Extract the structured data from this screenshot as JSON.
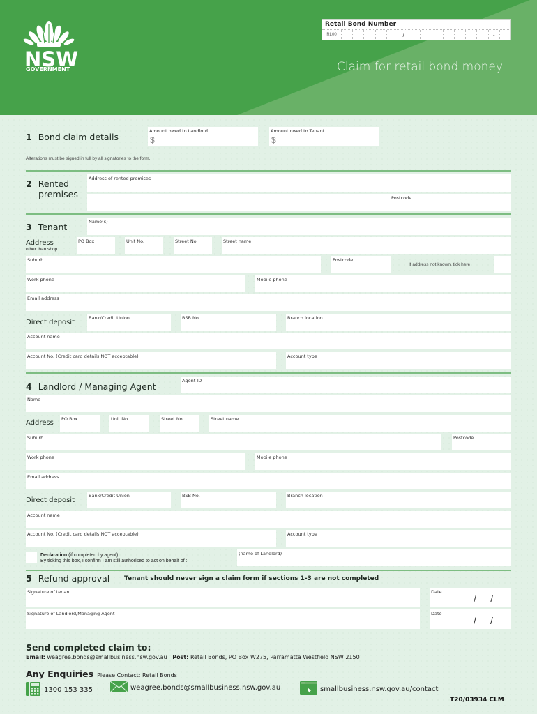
{
  "header": {
    "logo": {
      "name": "NSW",
      "sub": "GOVERNMENT",
      "icon": "waratah-icon"
    },
    "title": "Claim for retail bond money",
    "bond_number": {
      "label": "Retail Bond Number",
      "prefix": "RL00",
      "cells": [
        "",
        "",
        "",
        "",
        "",
        "/",
        "",
        "",
        "",
        "",
        "",
        "",
        "",
        "-",
        ""
      ]
    },
    "colors": {
      "brand_green": "#46a24a",
      "light_green": "#6db26a",
      "page_bg": "#e2f1e6",
      "divider": "#7dbd82"
    }
  },
  "section1": {
    "number": "1",
    "title": "Bond claim details",
    "landlord_label": "Amount owed to Landlord",
    "tenant_label": "Amount owed to Tenant",
    "currency": "$",
    "note": "Alterations must be signed in full by all signatories to the form."
  },
  "section2": {
    "number": "2",
    "title_line1": "Rented",
    "title_line2": "premises",
    "address_label": "Address of rented premises",
    "postcode_label": "Postcode"
  },
  "section3": {
    "number": "3",
    "title": "Tenant",
    "names_label": "Name(s)",
    "address_heading": "Address",
    "address_sub": "other than shop",
    "po_box": "PO Box",
    "unit_no": "Unit No.",
    "street_no": "Street No.",
    "street_name": "Street name",
    "suburb": "Suburb",
    "postcode": "Postcode",
    "unknown_address": "If address not known, tick here",
    "work_phone": "Work phone",
    "mobile_phone": "Mobile phone",
    "email": "Email address",
    "direct_deposit": "Direct deposit",
    "bank": "Bank/Credit Union",
    "bsb": "BSB No.",
    "branch": "Branch location",
    "account_name": "Account name",
    "account_no": "Account No. (Credit card details NOT acceptable)",
    "account_type": "Account type"
  },
  "section4": {
    "number": "4",
    "title": "Landlord / Managing Agent",
    "agent_id": "Agent ID",
    "name": "Name",
    "address_heading": "Address",
    "po_box": "PO Box",
    "unit_no": "Unit No.",
    "street_no": "Street No.",
    "street_name": "Street name",
    "suburb": "Suburb",
    "postcode": "Postcode",
    "work_phone": "Work phone",
    "mobile_phone": "Mobile phone",
    "email": "Email address",
    "direct_deposit": "Direct deposit",
    "bank": "Bank/Credit Union",
    "bsb": "BSB No.",
    "branch": "Branch location",
    "account_name": "Account name",
    "account_no": "Account No. (Credit card details NOT acceptable)",
    "account_type": "Account type",
    "declaration_bold": "Declaration",
    "declaration_paren": " (if completed by agent)",
    "declaration_text": "By ticking this box, I confirm I am still authorised to act on behalf of :",
    "landlord_name_label": "(name of Landlord)"
  },
  "section5": {
    "number": "5",
    "title": "Refund approval",
    "warning": "Tenant should never sign a claim form if sections 1-3 are not completed",
    "sig_tenant": "Signature of tenant",
    "sig_landlord": "Signature of Landlord/Managing Agent",
    "date": "Date",
    "date_sep": "/"
  },
  "footer": {
    "send_title": "Send completed claim to:",
    "email_label": "Email:",
    "email_value": "weagree.bonds@smallbusiness.nsw.gov.au",
    "post_label": "Post:",
    "post_value": "Retail Bonds, PO Box W275, Parramatta Westfield NSW 2150",
    "enquiries_title": "Any Enquiries",
    "enquiries_text": "Please Contact: Retail Bonds",
    "phone": "1300 153 335",
    "contact_email": "weagree.bonds@smallbusiness.nsw.gov.au",
    "website": "smallbusiness.nsw.gov.au/contact",
    "form_ref": "T20/03934 CLM"
  }
}
